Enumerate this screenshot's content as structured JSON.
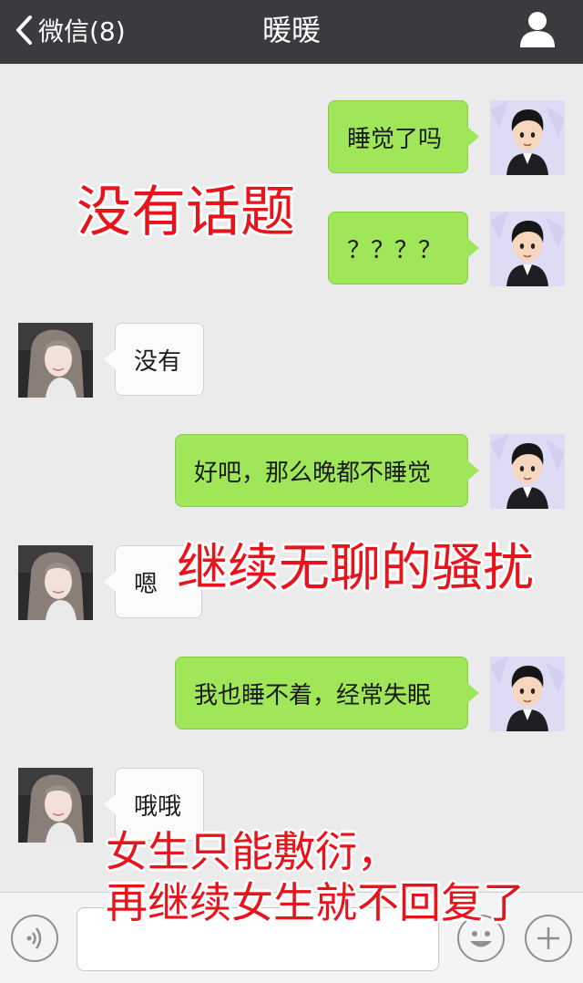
{
  "header": {
    "back_label": "微信(8)",
    "title": "暖暖"
  },
  "messages": [
    {
      "side": "out",
      "text": "睡觉了吗"
    },
    {
      "side": "out",
      "text": "？？？？"
    },
    {
      "side": "in",
      "text": "没有"
    },
    {
      "side": "out",
      "text": "好吧，那么晚都不睡觉"
    },
    {
      "side": "in",
      "text": "嗯"
    },
    {
      "side": "out",
      "text": "我也睡不着，经常失眠"
    },
    {
      "side": "in",
      "text": "哦哦"
    }
  ],
  "annotations": {
    "a1": "没有话题",
    "a2": "继续无聊的骚扰",
    "a3_line1": "女生只能敷衍，",
    "a3_line2": "再继续女生就不回复了"
  },
  "input": {
    "value": "",
    "placeholder": ""
  },
  "icons": {
    "back": "chevron-left-icon",
    "profile": "person-icon",
    "voice": "voice-icon",
    "emoji": "emoji-icon",
    "more": "plus-icon"
  },
  "colors": {
    "header_bg": "#3a3b3f",
    "chat_bg": "#ebebeb",
    "out_bubble": "#9fe658",
    "in_bubble": "#fbfbfb",
    "annotation": "#e8131b"
  }
}
